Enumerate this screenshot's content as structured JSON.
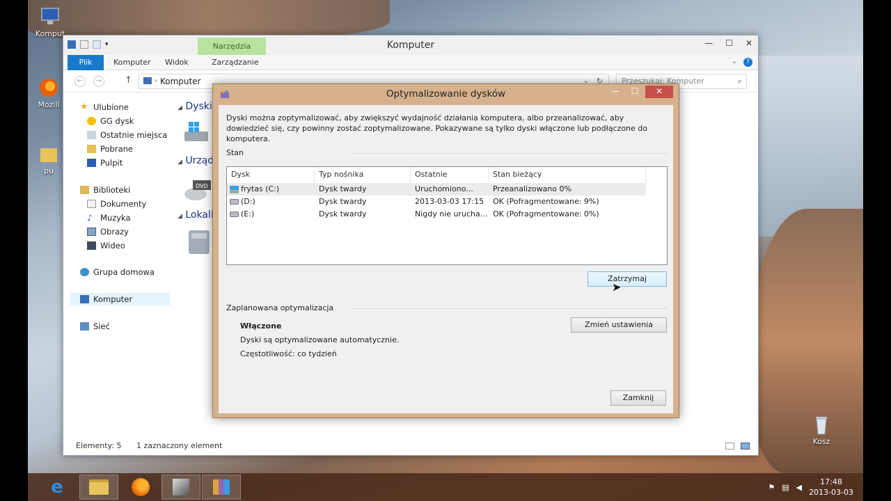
{
  "desktop": {
    "icons": [
      {
        "label": "Komput",
        "icon": "computer-icon"
      },
      {
        "label": "Mozill",
        "icon": "firefox-icon"
      },
      {
        "label": "pu",
        "icon": "folder-icon"
      },
      {
        "label": "Kosz",
        "icon": "recycle-bin-icon"
      }
    ]
  },
  "taskbar": {
    "items": [
      "internet-explorer-icon",
      "file-explorer-icon",
      "firefox-icon",
      "app-icon",
      "optimize-drives-icon"
    ],
    "clock_time": "17:48",
    "clock_date": "2013-03-03"
  },
  "explorer": {
    "title": "Komputer",
    "context_tab": "Narzędzia dysków",
    "tabs": [
      "Plik",
      "Komputer",
      "Widok",
      "Zarządzanie"
    ],
    "address": "Komputer",
    "search_placeholder": "Przeszukaj: Komputer",
    "nav": {
      "favorites": "Ulubione",
      "fav_items": [
        "GG dysk",
        "Ostatnie miejsca",
        "Pobrane",
        "Pulpit"
      ],
      "libraries": "Biblioteki",
      "lib_items": [
        "Dokumenty",
        "Muzyka",
        "Obrazy",
        "Wideo"
      ],
      "homegroup": "Grupa domowa",
      "computer": "Komputer",
      "network": "Sieć"
    },
    "groups": [
      "Dyski t",
      "Urządz",
      "Lokaliz"
    ],
    "status_count": "Elementy: 5",
    "status_selected": "1 zaznaczony element"
  },
  "dialog": {
    "title": "Optymalizowanie dysków",
    "description": "Dyski można zoptymalizować, aby zwiększyć wydajność działania komputera, albo przeanalizować, aby dowiedzieć się, czy powinny zostać zoptymalizowane. Pokazywane są tylko dyski włączone lub podłączone do komputera.",
    "status_label": "Stan",
    "columns": [
      "Dysk",
      "Typ nośnika",
      "Ostatnie uruchomi...",
      "Stan bieżący"
    ],
    "rows": [
      {
        "disk": "frytas (C:)",
        "type": "Dysk twardy",
        "last_run": "Uruchomiono...",
        "status": "Przeanalizowano 0%"
      },
      {
        "disk": "(D:)",
        "type": "Dysk twardy",
        "last_run": "2013-03-03 17:15",
        "status": "OK (Pofragmentowane: 9%)"
      },
      {
        "disk": "(E:)",
        "type": "Dysk twardy",
        "last_run": "Nigdy nie urucha...",
        "status": "OK (Pofragmentowane: 0%)"
      }
    ],
    "stop_button": "Zatrzymaj",
    "scheduled_label": "Zaplanowana optymalizacja",
    "scheduled_state": "Włączone",
    "scheduled_desc": "Dyski są optymalizowane automatycznie.",
    "scheduled_freq": "Częstotliwość: co tydzień",
    "change_settings_button": "Zmień ustawienia",
    "close_button": "Zamknij"
  }
}
